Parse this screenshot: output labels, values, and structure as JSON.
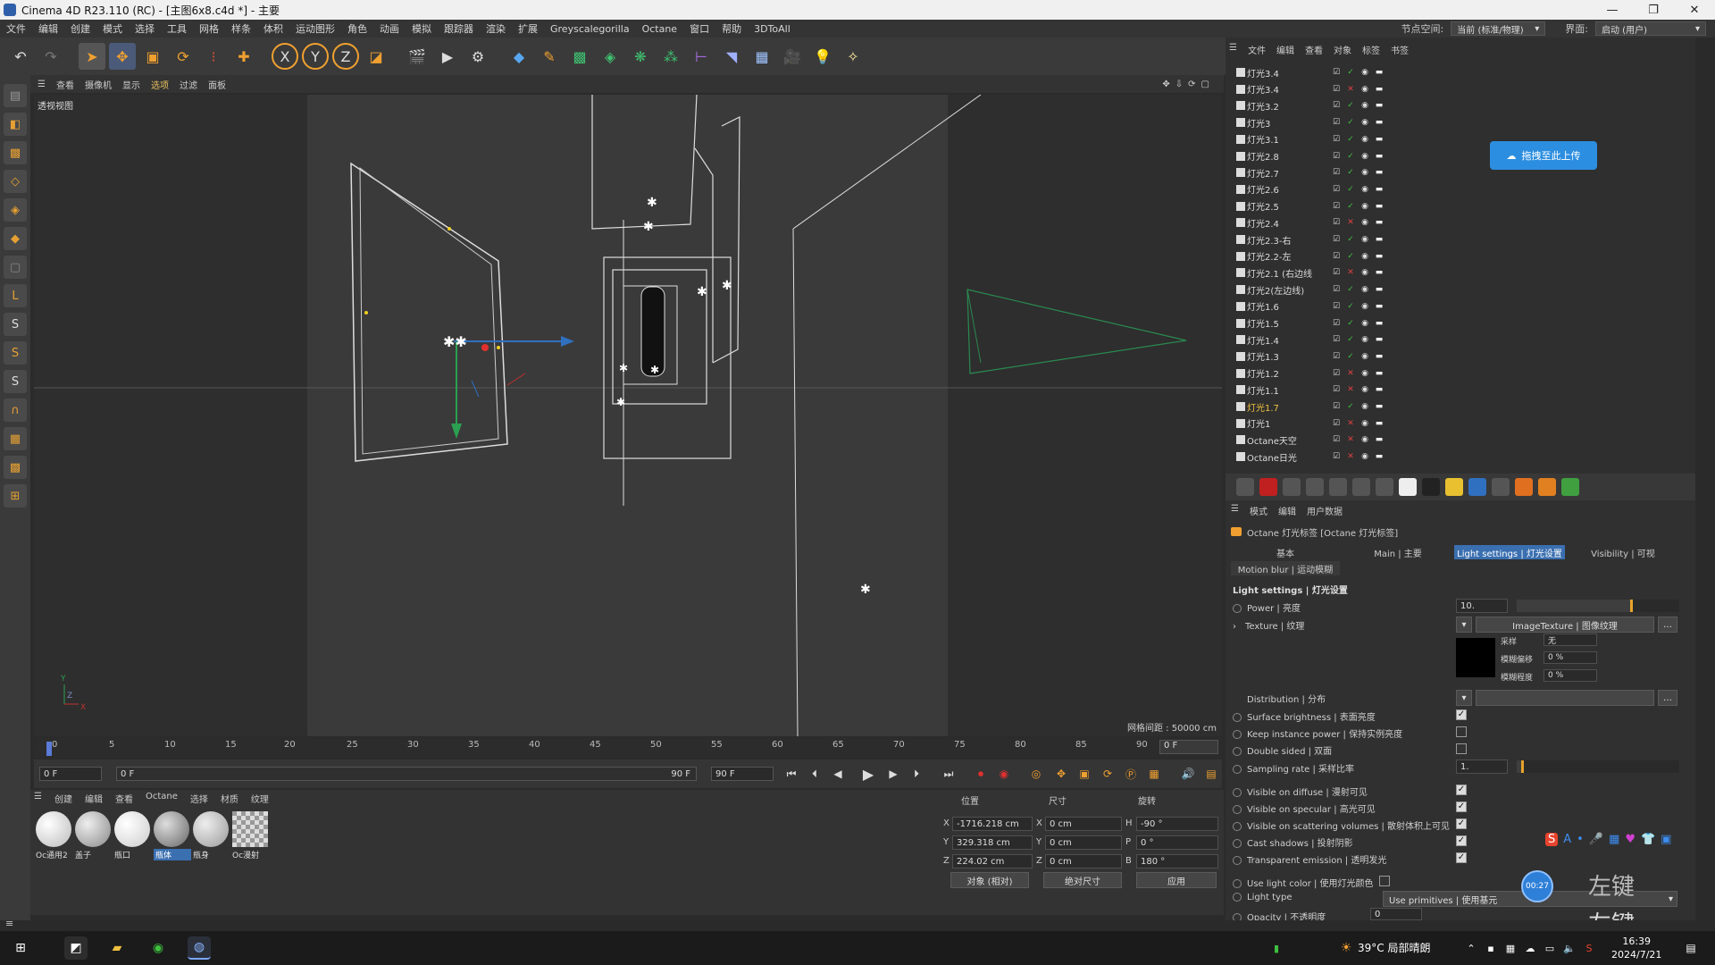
{
  "window": {
    "title": "Cinema 4D R23.110 (RC) - [主图6x8.c4d *] - 主要",
    "controls": [
      "—",
      "❐",
      "✕"
    ]
  },
  "menu": {
    "items": [
      "文件",
      "编辑",
      "创建",
      "模式",
      "选择",
      "工具",
      "网格",
      "样条",
      "体积",
      "运动图形",
      "角色",
      "动画",
      "模拟",
      "跟踪器",
      "渲染",
      "扩展",
      "Greyscalegorilla",
      "Octane",
      "窗口",
      "帮助",
      "3DToAll"
    ],
    "node_space_label": "节点空间:",
    "node_space_value": "当前 (标准/物理)",
    "layout_label": "界面:",
    "layout_value": "启动 (用户)"
  },
  "toolbar": {
    "icons": [
      "undo-icon",
      "redo-icon",
      "select-icon",
      "move-icon",
      "scale-icon",
      "rotate-icon",
      "recent-icon",
      "add-icon",
      "x-axis-icon",
      "y-axis-icon",
      "z-axis-icon",
      "coordinate-icon",
      "render-view-icon",
      "render-icon",
      "render-settings-icon",
      "cube-icon",
      "pen-icon",
      "subdivide-icon",
      "extrude-icon",
      "cloner-icon",
      "mograph-icon",
      "deformer-icon",
      "field-icon",
      "floor-icon",
      "camera-icon",
      "light-icon",
      "octane-light-icon"
    ]
  },
  "viewport": {
    "menu": [
      "查看",
      "摄像机",
      "显示",
      "选项",
      "过滤",
      "面板"
    ],
    "label": "透视视图",
    "grid_label": "网格间距 : 50000 cm",
    "axis_labels": {
      "y": "Y",
      "z": "Z",
      "x": "X"
    }
  },
  "timeline": {
    "ticks": [
      "0",
      "5",
      "10",
      "15",
      "20",
      "25",
      "30",
      "35",
      "40",
      "45",
      "50",
      "55",
      "60",
      "65",
      "70",
      "75",
      "80",
      "85",
      "90"
    ],
    "current_frame": "0 F",
    "start_field": "0 F",
    "range_start": "0 F",
    "range_end": "90 F",
    "end_field": "90 F"
  },
  "materials": {
    "menu": [
      "创建",
      "编辑",
      "查看",
      "Octane",
      "选择",
      "材质",
      "纹理"
    ],
    "items": [
      {
        "label": "Oc通用2",
        "color": "#f2f2f2"
      },
      {
        "label": "盖子",
        "color": "#bdbdbd"
      },
      {
        "label": "瓶口",
        "color": "#e8e8e8"
      },
      {
        "label": "瓶体",
        "color": "#9a9a9a"
      },
      {
        "label": "瓶身",
        "color": "#c9c9c9"
      },
      {
        "label": "Oc漫射",
        "color": "checker"
      }
    ]
  },
  "coordinates": {
    "headers": [
      "位置",
      "尺寸",
      "旋转"
    ],
    "rows": [
      {
        "axis": "X",
        "pos": "-1716.218 cm",
        "size": "0 cm",
        "rot_label": "H",
        "rot": "-90 °"
      },
      {
        "axis": "Y",
        "pos": "329.318 cm",
        "size": "0 cm",
        "rot_label": "P",
        "rot": "0 °"
      },
      {
        "axis": "Z",
        "pos": "224.02 cm",
        "size": "0 cm",
        "rot_label": "B",
        "rot": "180 °"
      }
    ],
    "mode_dd": "对象 (相对)",
    "size_dd": "绝对尺寸",
    "apply_btn": "应用"
  },
  "object_manager": {
    "menu": [
      "文件",
      "编辑",
      "查看",
      "对象",
      "标签",
      "书签"
    ],
    "objects": [
      {
        "name": "灯光3.4",
        "on": true
      },
      {
        "name": "灯光3.4",
        "on": false
      },
      {
        "name": "灯光3.2",
        "on": true
      },
      {
        "name": "灯光3",
        "on": true
      },
      {
        "name": "灯光3.1",
        "on": true
      },
      {
        "name": "灯光2.8",
        "on": true
      },
      {
        "name": "灯光2.7",
        "on": true
      },
      {
        "name": "灯光2.6",
        "on": true
      },
      {
        "name": "灯光2.5",
        "on": true
      },
      {
        "name": "灯光2.4",
        "on": false
      },
      {
        "name": "灯光2.3-右",
        "on": true
      },
      {
        "name": "灯光2.2-左",
        "on": true
      },
      {
        "name": "灯光2.1 (右边线",
        "on": false
      },
      {
        "name": "灯光2(左边线)",
        "on": true
      },
      {
        "name": "灯光1.6",
        "on": true
      },
      {
        "name": "灯光1.5",
        "on": true
      },
      {
        "name": "灯光1.4",
        "on": true
      },
      {
        "name": "灯光1.3",
        "on": true
      },
      {
        "name": "灯光1.2",
        "on": false
      },
      {
        "name": "灯光1.1",
        "on": false
      },
      {
        "name": "灯光1.7",
        "on": true
      },
      {
        "name": "灯光1",
        "on": false
      },
      {
        "name": "Octane天空",
        "on": false
      },
      {
        "name": "Octane日光",
        "on": false
      }
    ],
    "selected_index": 20,
    "badge": "拖拽至此上传"
  },
  "attributes": {
    "menu": [
      "模式",
      "编辑",
      "用户数据"
    ],
    "title": "Octane 灯光标签 [Octane 灯光标签]",
    "tabs": [
      "基本",
      "Main | 主要",
      "Light settings | 灯光设置",
      "Visibility | 可视"
    ],
    "tab_row2": "Motion blur | 运动模糊",
    "section": "Light settings | 灯光设置",
    "power_label": "Power | 亮度",
    "power_value": "10.",
    "power_fraction": 0.7,
    "texture_label": "Texture | 纹理",
    "texture_btn": "ImageTexture | 图像纹理",
    "sampling_sub": "采样",
    "sampling_sub_value": "无",
    "blur_offset_label": "模糊偏移",
    "blur_offset_value": "0 %",
    "blur_scale_label": "模糊程度",
    "blur_scale_value": "0 %",
    "distribution_label": "Distribution | 分布",
    "rows": [
      {
        "label": "Surface brightness | 表面亮度",
        "checked": true
      },
      {
        "label": "Keep instance power | 保持实例亮度",
        "checked": false
      },
      {
        "label": "Double sided | 双面",
        "checked": false
      }
    ],
    "sampling_label": "Sampling rate | 采样比率",
    "sampling_value": "1.",
    "sampling_fraction": 0.03,
    "vis_rows": [
      {
        "label": "Visible on diffuse | 漫射可见",
        "checked": true
      },
      {
        "label": "Visible on specular | 高光可见",
        "checked": true
      },
      {
        "label": "Visible on scattering volumes | 散射体积上可见",
        "checked": true
      },
      {
        "label": "Cast shadows | 投射阴影",
        "checked": true
      },
      {
        "label": "Transparent emission | 透明发光",
        "checked": true
      }
    ],
    "light_color_label": "Use light color | 使用灯光颜色",
    "light_type_label": "Light type",
    "light_type_value": "Use primitives | 使用基元",
    "opacity_label": "Opacity | 不透明度",
    "opacity_value": "0"
  },
  "overlay": {
    "watermark": "左键",
    "circle_text": "00:27",
    "ime": [
      "S",
      "A",
      "•",
      "🎤",
      "▦",
      "♥",
      "👕",
      "▣"
    ]
  },
  "taskbar": {
    "weather": "39°C 局部晴朗",
    "time": "16:39",
    "date": "2024/7/21"
  }
}
